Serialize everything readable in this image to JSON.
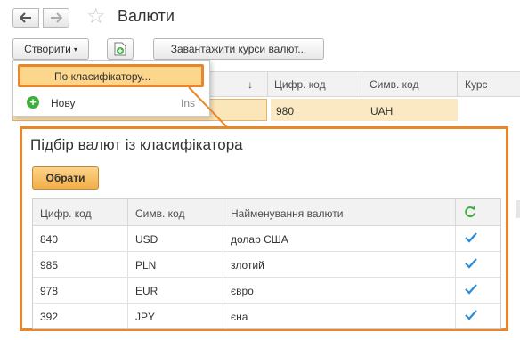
{
  "header": {
    "back_icon": "arrow-left-icon",
    "forward_icon": "arrow-right-icon",
    "favorite_icon": "star-icon",
    "title": "Валюти"
  },
  "toolbar": {
    "create_label": "Створити",
    "create_caret": "▾",
    "add_icon": "add-document-icon",
    "load_rates_label": "Завантажити курси валют..."
  },
  "create_menu": {
    "items": [
      {
        "label": "По класифікатору...",
        "highlighted": true
      },
      {
        "label": "Нову",
        "shortcut": "Ins",
        "icon": "plus-circle-icon"
      }
    ]
  },
  "main_table": {
    "sort_arrow": "↓",
    "columns": [
      "Цифр. код",
      "Симв. код",
      "Курс"
    ],
    "row": {
      "digital_code": "980",
      "symbol_code": "UAH"
    }
  },
  "picker": {
    "title": "Підбір валют із класифікатора",
    "pick_button": "Обрати",
    "columns": [
      "Цифр. код",
      "Симв. код",
      "Найменування валюти"
    ],
    "refresh_icon": "refresh-icon",
    "rows": [
      {
        "digital_code": "840",
        "symbol_code": "USD",
        "name": "долар США",
        "checked": true
      },
      {
        "digital_code": "985",
        "symbol_code": "PLN",
        "name": "злотий",
        "checked": true
      },
      {
        "digital_code": "978",
        "symbol_code": "EUR",
        "name": "євро",
        "checked": true
      },
      {
        "digital_code": "392",
        "symbol_code": "JPY",
        "name": "єна",
        "checked": true
      }
    ]
  },
  "colors": {
    "highlight_border": "#e8862b",
    "highlight_fill": "#fcd68a",
    "check": "#2a8ad6",
    "refresh": "#3fae3f"
  }
}
